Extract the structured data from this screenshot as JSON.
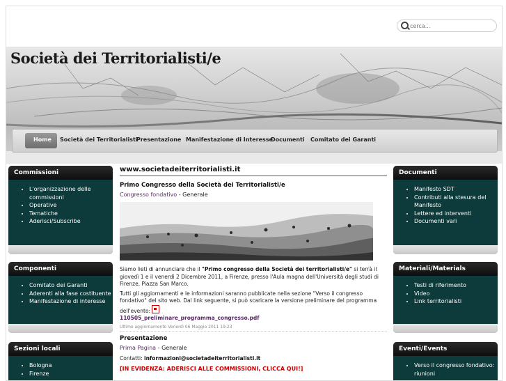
{
  "search": {
    "placeholder": "cerca..."
  },
  "site": {
    "title": "Società dei Territorialisti/e"
  },
  "nav": [
    "Home",
    "Società dei Territorialisti",
    "Presentazione",
    "Manifestazione di Interesse",
    "Documenti",
    "Comitato dei Garanti"
  ],
  "left": [
    {
      "title": "Commissioni",
      "items": [
        "L'organizzazione delle commissioni",
        "Operative",
        "Tematiche",
        "Aderisci/Subscribe"
      ]
    },
    {
      "title": "Componenti",
      "items": [
        "Comitato dei Garanti",
        "Aderenti alla fase costituente",
        "Manifestazione di interesse"
      ]
    },
    {
      "title": "Sezioni locali",
      "items": [
        "Bologna",
        "Firenze"
      ]
    }
  ],
  "right": [
    {
      "title": "Documenti",
      "items": [
        "Manifesto SDT",
        "Contributi alla stesura del Manifesto",
        "Lettere ed interventi",
        "Documenti vari"
      ]
    },
    {
      "title": "Materiali/Materials",
      "items": [
        "Testi di riferimento",
        "Video",
        "Link territorialisti"
      ]
    },
    {
      "title": "Eventi/Events",
      "items": [
        "Verso il congresso fondativo: riunioni"
      ]
    }
  ],
  "main": {
    "site_url": "www.societadeiterritorialisti.it",
    "article1": {
      "title": "Primo Congresso della Società dei Territorialisti/e",
      "category": "Congresso fondativo",
      "sep": " - ",
      "section": "Generale",
      "para1_a": "Siamo lieti di annunciare che il ",
      "para1_b": "\"Primo congresso della Società dei territorialisti/e\"",
      "para1_c": " si terrà il giovedì 1 e il venerdì 2 Dicembre 2011, a Firenze, presso l'Aula magna dell'Università degli studi di Firenze, Piazza San Marco.",
      "para2": "Tutti gli aggiornamenti e le informazioni saranno pubblicate nella sezione \"Verso il congresso fondativo\" del sito web. Dal link seguente, si può scaricare la versione preliminare del programma dell'evento:",
      "pdf_link": "110505_preliminare_programma_congresso.pdf",
      "updated": "Ultimo aggiornamento Venerdì 06 Maggio 2011 19:23"
    },
    "article2": {
      "title": "Presentazione",
      "category": "Prima Pagina",
      "sep": " - ",
      "section": "Generale",
      "contacts_label": "Contatti: ",
      "contacts_email": "informazioni@societadeiterritorialisti.it",
      "alert": "[IN EVIDENZA:  ADERISCI ALLE COMMISSIONI, CLICCA QUI!]"
    }
  }
}
